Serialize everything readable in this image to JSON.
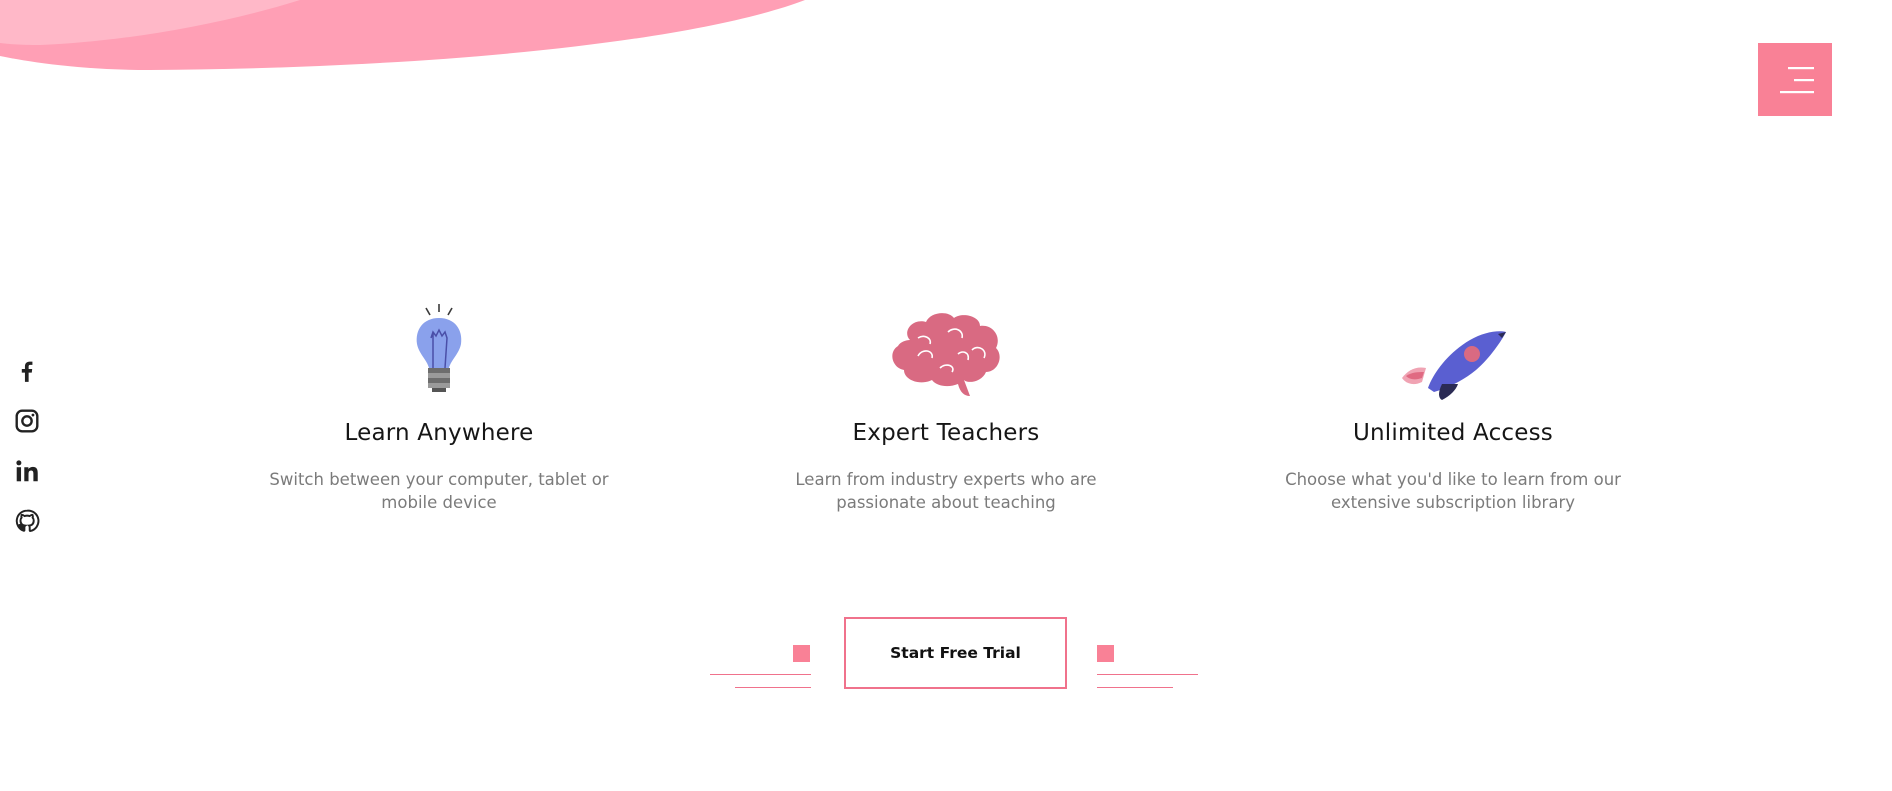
{
  "colors": {
    "accent": "#f98196",
    "blob_pink": "#ff9fb5",
    "blob_light": "#ffb8c8",
    "heading": "#161616",
    "body_text": "#7b7b7b"
  },
  "header": {
    "menu_icon": "hamburger-menu-icon"
  },
  "social": [
    {
      "name": "facebook",
      "icon": "facebook-icon"
    },
    {
      "name": "instagram",
      "icon": "instagram-icon"
    },
    {
      "name": "linkedin",
      "icon": "linkedin-icon"
    },
    {
      "name": "github",
      "icon": "github-icon"
    }
  ],
  "features": [
    {
      "icon": "lightbulb-icon",
      "title": "Learn Anywhere",
      "description": "Switch between your computer, tablet or mobile device"
    },
    {
      "icon": "brain-icon",
      "title": "Expert Teachers",
      "description": "Learn from industry experts who are passionate about teaching"
    },
    {
      "icon": "rocket-icon",
      "title": "Unlimited Access",
      "description": "Choose what you'd like to learn from our extensive subscription library"
    }
  ],
  "cta": {
    "label": "Start Free Trial"
  }
}
